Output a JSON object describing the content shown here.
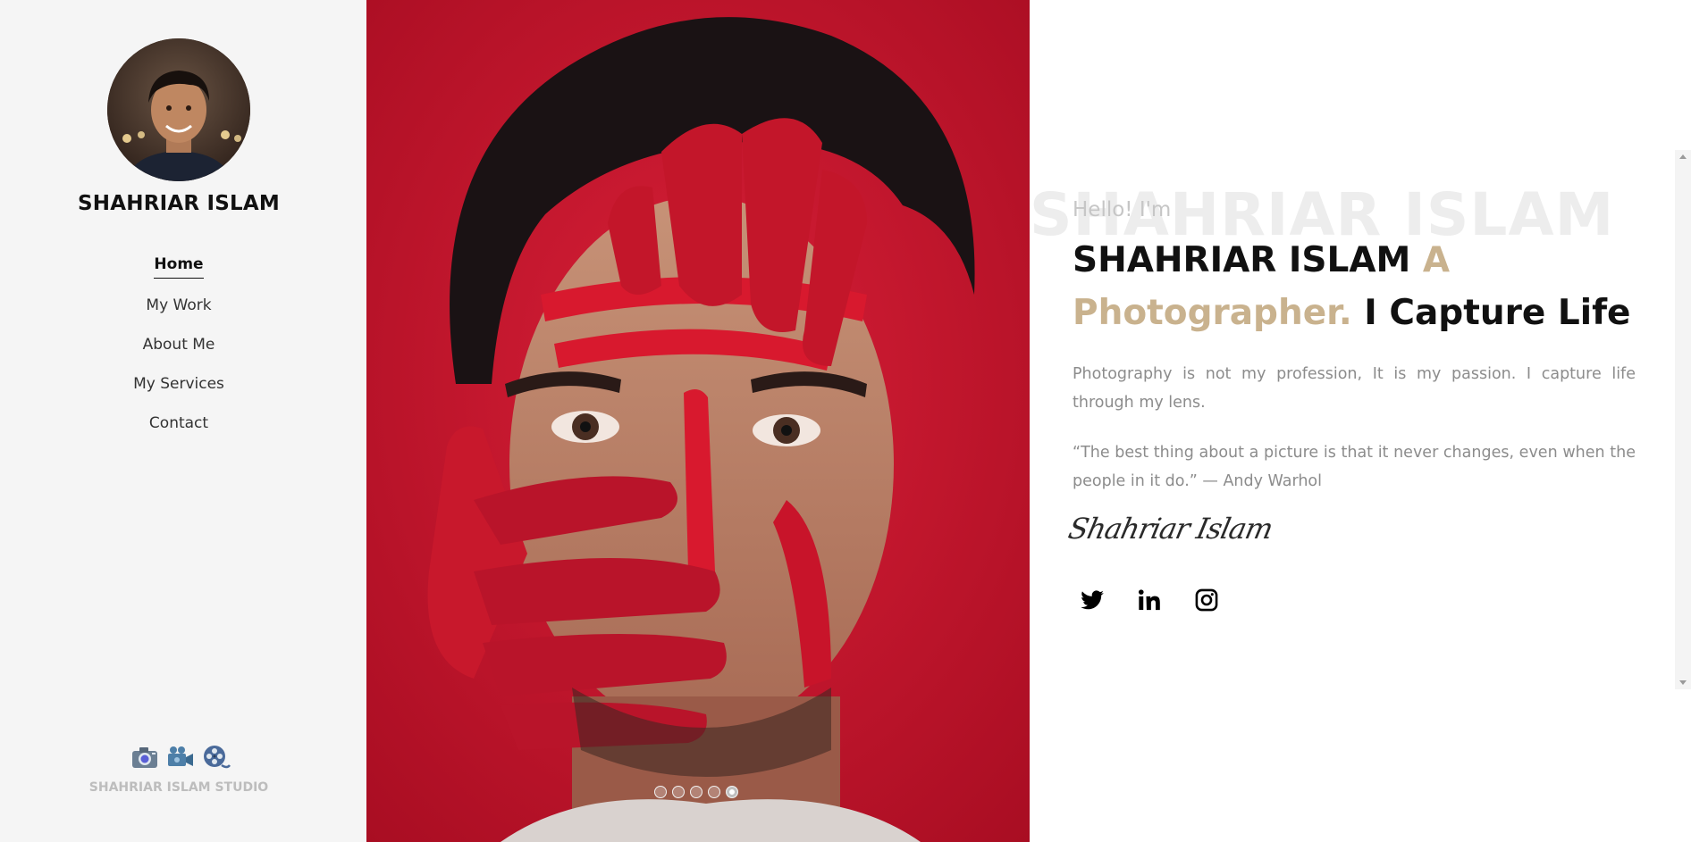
{
  "sidebar": {
    "name": "SHAHRIAR ISLAM",
    "nav": [
      {
        "label": "Home",
        "active": true
      },
      {
        "label": "My Work",
        "active": false
      },
      {
        "label": "About Me",
        "active": false
      },
      {
        "label": "My Services",
        "active": false
      },
      {
        "label": "Contact",
        "active": false
      }
    ],
    "studio_icons": [
      "camera-icon",
      "video-camera-icon",
      "film-reel-icon"
    ],
    "studio_name": "SHAHRIAR ISLAM STUDIO"
  },
  "hero": {
    "slides_total": 5,
    "active_slide": 5,
    "background_color": "#c2102a"
  },
  "content": {
    "ghost_name": "SHAHRIAR ISLAM",
    "hello": "Hello! I'm",
    "headline_name": "SHAHRIAR ISLAM",
    "headline_accent": "A Photographer.",
    "headline_tail": "I Capture Life",
    "paragraph_1": "Photography is not my profession, It is my passion. I capture life through my lens.",
    "paragraph_2": "“The best thing about a picture is that it never changes, even when the people in it do.” — Andy Warhol",
    "signature": "Shahriar Islam",
    "socials": [
      "twitter-icon",
      "linkedin-icon",
      "instagram-icon"
    ]
  },
  "colors": {
    "accent": "#c9b28e",
    "sidebar_bg": "#f5f5f5",
    "text_dark": "#111111",
    "text_muted": "#8c8c8c"
  }
}
